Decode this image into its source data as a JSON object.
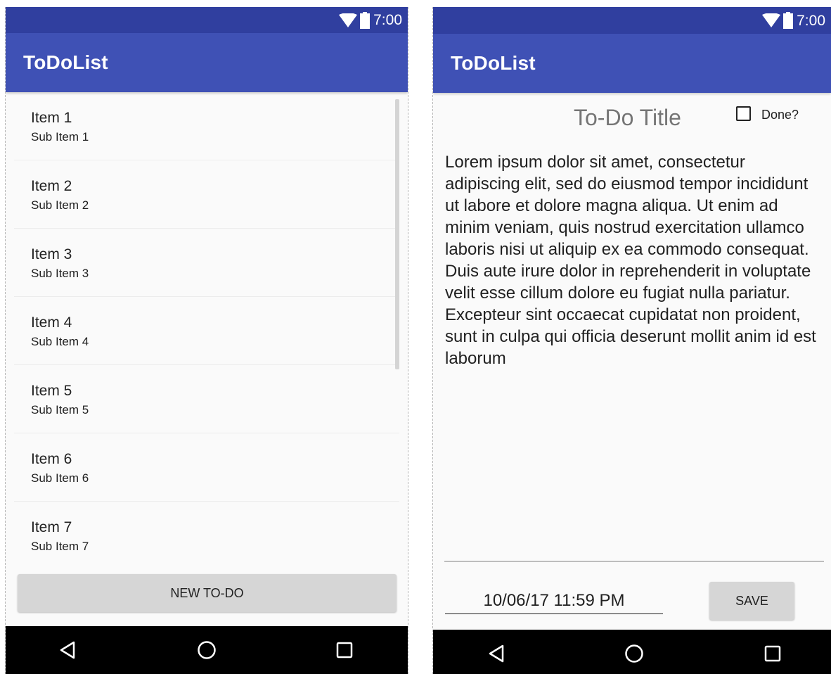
{
  "list_screen": {
    "status_time": "7:00",
    "app_title": "ToDoList",
    "items": [
      {
        "title": "Item 1",
        "subtitle": "Sub Item 1"
      },
      {
        "title": "Item 2",
        "subtitle": "Sub Item 2"
      },
      {
        "title": "Item 3",
        "subtitle": "Sub Item 3"
      },
      {
        "title": "Item 4",
        "subtitle": "Sub Item 4"
      },
      {
        "title": "Item 5",
        "subtitle": "Sub Item 5"
      },
      {
        "title": "Item 6",
        "subtitle": "Sub Item 6"
      },
      {
        "title": "Item 7",
        "subtitle": "Sub Item 7"
      }
    ],
    "new_button_label": "NEW TO-DO"
  },
  "detail_screen": {
    "status_time": "7:00",
    "app_title": "ToDoList",
    "todo_title": "To-Do Title",
    "done_label": "Done?",
    "done_checked": false,
    "body": "Lorem ipsum dolor sit amet, consectetur adipiscing elit, sed do eiusmod tempor incididunt ut labore et dolore magna aliqua. Ut enim ad minim veniam, quis nostrud exercitation ullamco laboris nisi ut aliquip ex ea commodo consequat. Duis aute irure dolor in reprehenderit in voluptate velit esse cillum dolore eu fugiat nulla pariatur. Excepteur sint occaecat cupidatat non proident, sunt in culpa qui officia deserunt mollit anim id est laborum",
    "due_date": "10/06/17 11:59 PM",
    "save_label": "SAVE"
  },
  "colors": {
    "status_bar": "#303f9f",
    "app_bar": "#3f51b5",
    "nav_bar": "#000000"
  },
  "icons": [
    "wifi-icon",
    "battery-icon",
    "back-icon",
    "home-icon",
    "recents-icon"
  ]
}
